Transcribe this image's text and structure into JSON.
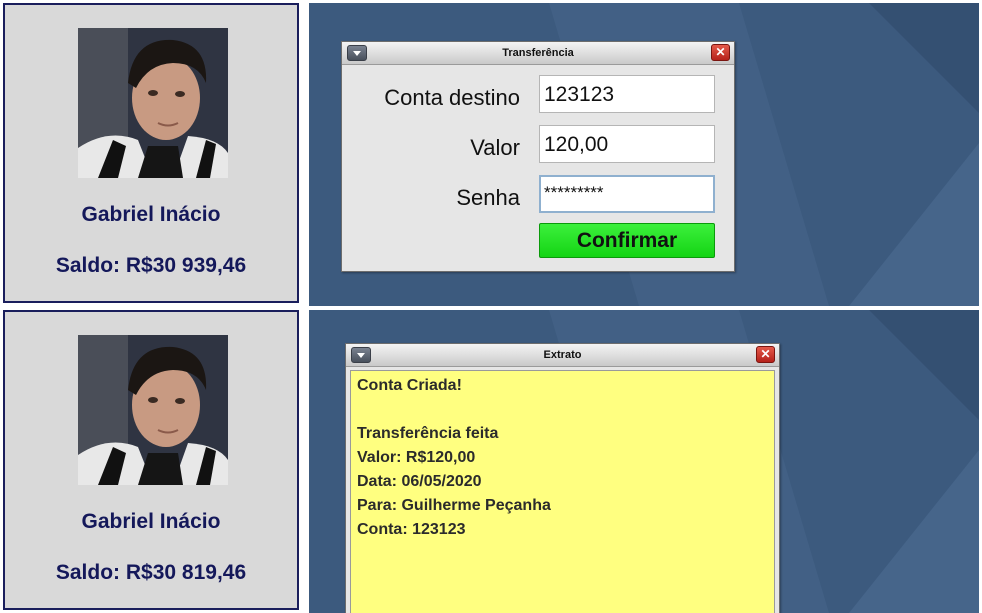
{
  "user": {
    "name": "Gabriel Inácio"
  },
  "top_card": {
    "balance": "Saldo: R$30 939,46"
  },
  "bottom_card": {
    "balance": "Saldo: R$30 819,46"
  },
  "transfer_window": {
    "title": "Transferência",
    "close_glyph": "✕",
    "fields": {
      "account_label": "Conta destino",
      "account_value": "123123",
      "amount_label": "Valor",
      "amount_value": "120,00",
      "password_label": "Senha",
      "password_value": "*********"
    },
    "confirm_label": "Confirmar"
  },
  "statement_window": {
    "title": "Extrato",
    "close_glyph": "✕",
    "lines": [
      "Conta Criada!",
      "",
      "Transferência feita",
      "Valor: R$120,00",
      "Data: 06/05/2020",
      "Para: Guilherme Peçanha",
      "Conta: 123123"
    ]
  },
  "colors": {
    "card_border": "#1a1e5c",
    "text_accent": "#14185a",
    "desktop_bg": "#3c5a7e",
    "confirm_green": "#22e022",
    "statement_bg": "#ffff80"
  },
  "icons": {
    "system_menu": "chevron-down-icon",
    "close": "close-icon"
  }
}
